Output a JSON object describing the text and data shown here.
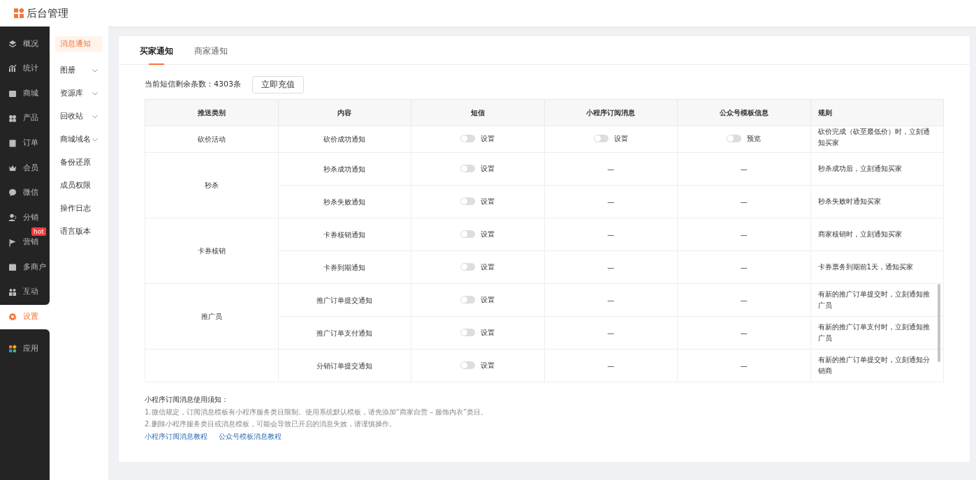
{
  "header": {
    "title": "后台管理"
  },
  "main_nav": [
    {
      "label": "概况",
      "selected": false
    },
    {
      "label": "统计",
      "selected": false
    },
    {
      "label": "商城",
      "selected": false
    },
    {
      "label": "产品",
      "selected": false
    },
    {
      "label": "订单",
      "selected": false
    },
    {
      "label": "会员",
      "selected": false
    },
    {
      "label": "微信",
      "selected": false
    },
    {
      "label": "分销",
      "selected": false
    },
    {
      "label": "营销",
      "selected": false,
      "badge": "hot"
    },
    {
      "label": "多商户",
      "selected": false
    },
    {
      "label": "互动",
      "selected": false
    },
    {
      "label": "设置",
      "selected": true
    },
    {
      "label": "应用",
      "selected": false
    }
  ],
  "sub_nav": [
    {
      "label": "消息通知",
      "selected": true,
      "expandable": false
    },
    {
      "label": "图册",
      "selected": false,
      "expandable": true
    },
    {
      "label": "资源库",
      "selected": false,
      "expandable": true
    },
    {
      "label": "回收站",
      "selected": false,
      "expandable": true
    },
    {
      "label": "商城域名",
      "selected": false,
      "expandable": true
    },
    {
      "label": "备份还原",
      "selected": false,
      "expandable": false
    },
    {
      "label": "成员权限",
      "selected": false,
      "expandable": false
    },
    {
      "label": "操作日志",
      "selected": false,
      "expandable": false
    },
    {
      "label": "语言版本",
      "selected": false,
      "expandable": false
    }
  ],
  "tabs": [
    {
      "label": "买家通知",
      "selected": true
    },
    {
      "label": "商家通知",
      "selected": false
    }
  ],
  "sms_balance": "当前短信剩余条数：4303条",
  "recharge_button": "立即充值",
  "table": {
    "columns": [
      "推送类别",
      "内容",
      "短信",
      "小程序订阅消息",
      "公众号模板信息",
      "规则"
    ],
    "groups": [
      {
        "category": "砍价活动",
        "rows": [
          {
            "content": "砍价成功通知",
            "cells": [
              {
                "kind": "toggle",
                "on": false,
                "action": "设置"
              },
              {
                "kind": "toggle",
                "on": false,
                "action": "设置"
              },
              {
                "kind": "toggle",
                "on": false,
                "action": "预览"
              }
            ],
            "rule": "砍价完成（砍至最低价）时，立刻通知买家"
          }
        ]
      },
      {
        "category": "秒杀",
        "rows": [
          {
            "content": "秒杀成功通知",
            "cells": [
              {
                "kind": "toggle",
                "on": false,
                "action": "设置"
              },
              {
                "kind": "dash",
                "text": "—"
              },
              {
                "kind": "dash",
                "text": "—"
              }
            ],
            "rule": "秒杀成功后，立刻通知买家"
          },
          {
            "content": "秒杀失败通知",
            "cells": [
              {
                "kind": "toggle",
                "on": false,
                "action": "设置"
              },
              {
                "kind": "dash",
                "text": "—"
              },
              {
                "kind": "dash",
                "text": "—"
              }
            ],
            "rule": "秒杀失败时通知买家"
          }
        ]
      },
      {
        "category": "卡券核销",
        "rows": [
          {
            "content": "卡券核销通知",
            "cells": [
              {
                "kind": "toggle",
                "on": false,
                "action": "设置"
              },
              {
                "kind": "dash",
                "text": "—"
              },
              {
                "kind": "dash",
                "text": "—"
              }
            ],
            "rule": "商家核销时，立刻通知买家"
          },
          {
            "content": "卡券到期通知",
            "cells": [
              {
                "kind": "toggle",
                "on": false,
                "action": "设置"
              },
              {
                "kind": "dash",
                "text": "—"
              },
              {
                "kind": "dash",
                "text": "—"
              }
            ],
            "rule": "卡券票务到期前1天，通知买家"
          }
        ]
      },
      {
        "category": "推广员",
        "rows": [
          {
            "content": "推广订单提交通知",
            "cells": [
              {
                "kind": "toggle",
                "on": false,
                "action": "设置"
              },
              {
                "kind": "dash",
                "text": "—"
              },
              {
                "kind": "dash",
                "text": "—"
              }
            ],
            "rule": "有新的推广订单提交时，立刻通知推广员"
          },
          {
            "content": "推广订单支付通知",
            "cells": [
              {
                "kind": "toggle",
                "on": false,
                "action": "设置"
              },
              {
                "kind": "dash",
                "text": "—"
              },
              {
                "kind": "dash",
                "text": "—"
              }
            ],
            "rule": "有新的推广订单支付时，立刻通知推广员"
          }
        ]
      },
      {
        "rows": [
          {
            "content": "分销订单提交通知",
            "cells": [
              {
                "kind": "toggle",
                "on": false,
                "action": "设置"
              },
              {
                "kind": "dash",
                "text": "—"
              },
              {
                "kind": "dash",
                "text": "—"
              }
            ],
            "rule": "有新的推广订单提交时，立刻通知分销商"
          }
        ]
      }
    ]
  },
  "notice": {
    "title": "小程序订阅消息使用须知：",
    "lines": [
      "1.微信规定，订阅消息模板有小程序服务类目限制。使用系统默认模板，请先添加“商家自营 – 服饰内衣”类目。",
      "2.删除小程序服务类目或消息模板，可能会导致已开启的消息失效，请谨慎操作。"
    ],
    "links": [
      "小程序订阅消息教程",
      "公众号模板消息教程"
    ]
  }
}
